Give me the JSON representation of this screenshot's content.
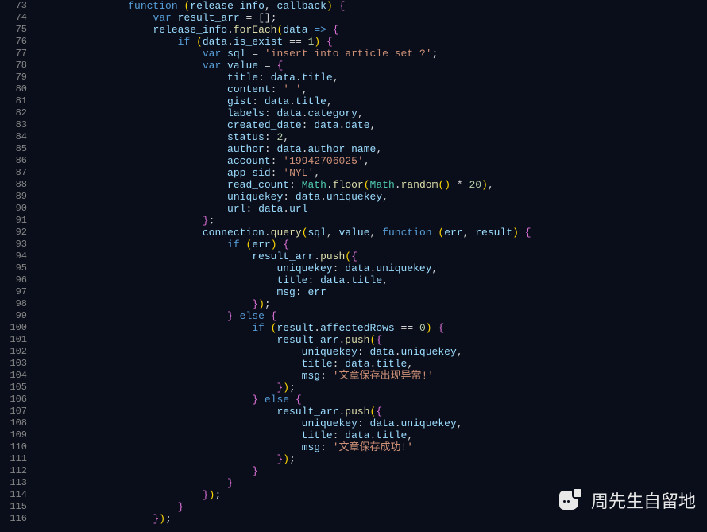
{
  "line_start": 73,
  "line_end": 116,
  "indent_base": "              ",
  "tokens": {
    "function": "function",
    "var": "var",
    "if": "if",
    "else": "else",
    "release_info": "release_info",
    "callback": "callback",
    "result_arr": "result_arr",
    "forEach": "forEach",
    "data": "data",
    "is_exist": "is_exist",
    "sql": "sql",
    "sql_str": "'insert into article set ?'",
    "value": "value",
    "title": "title",
    "content": "content",
    "content_str": "' '",
    "gist": "gist",
    "labels": "labels",
    "category": "category",
    "created_date": "created_date",
    "date": "date",
    "status": "status",
    "status_val": "2",
    "author": "author",
    "author_name": "author_name",
    "account": "account",
    "account_str": "'19942706025'",
    "app_sid": "app_sid",
    "app_sid_str": "'NYL'",
    "read_count": "read_count",
    "Math": "Math",
    "floor": "floor",
    "random": "random",
    "twenty": "20",
    "uniquekey": "uniquekey",
    "url": "url",
    "connection": "connection",
    "query": "query",
    "err": "err",
    "result": "result",
    "push": "push",
    "msg": "msg",
    "affectedRows": "affectedRows",
    "zero": "0",
    "one": "1",
    "err_msg_str": "'文章保存出现异常!'",
    "ok_msg_str": "'文章保存成功!'",
    "arrow": "=>"
  },
  "watermark": {
    "text": "周先生自留地",
    "icon": "wechat-chat-icon"
  }
}
